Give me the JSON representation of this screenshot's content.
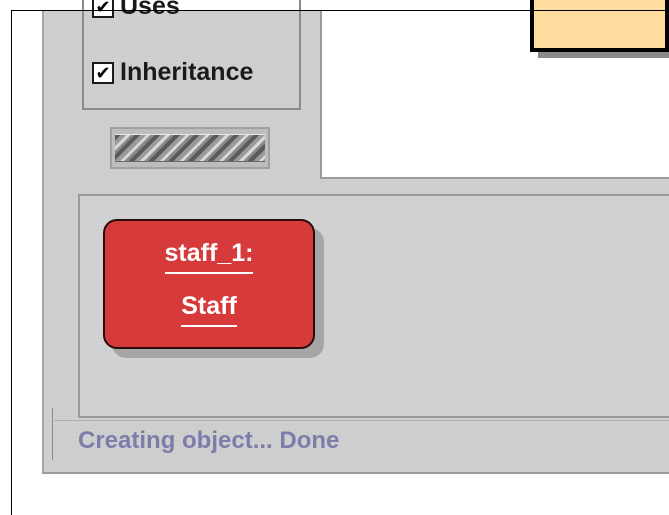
{
  "options": {
    "uses_label": "Uses",
    "uses_checked": true,
    "inheritance_label": "Inheritance",
    "inheritance_checked": true,
    "check_glyph": "✔"
  },
  "object": {
    "name": "staff_1:",
    "type": "Staff",
    "fill_color": "#d63a3a"
  },
  "class_box": {
    "fill_color": "#fddc9e"
  },
  "status": {
    "message": "Creating object... Done"
  }
}
